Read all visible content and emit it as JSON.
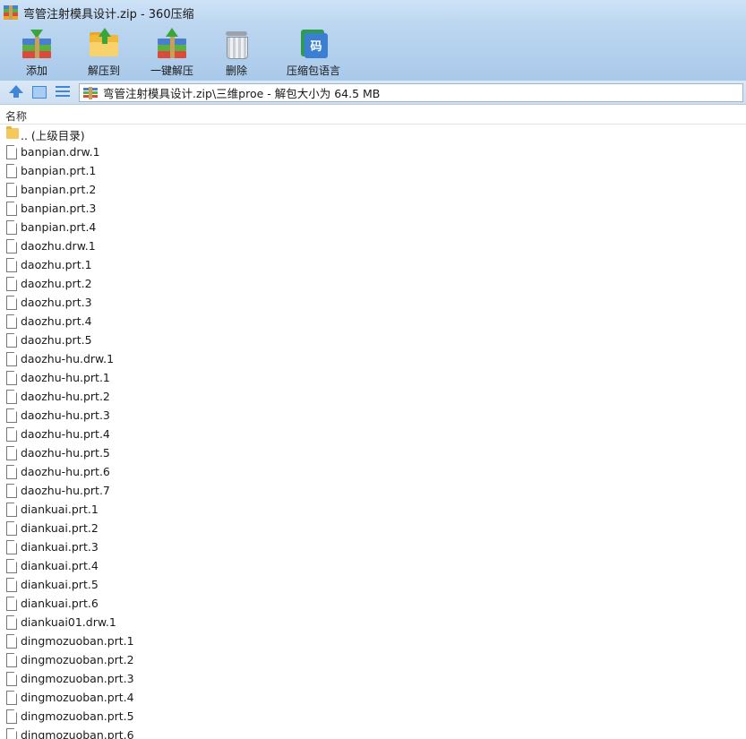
{
  "window": {
    "title": "弯管注射模具设计.zip - 360压缩"
  },
  "toolbar": {
    "buttons": [
      {
        "label": "添加",
        "icon": "add-archive-icon"
      },
      {
        "label": "解压到",
        "icon": "extract-to-folder-icon"
      },
      {
        "label": "一键解压",
        "icon": "one-click-extract-icon"
      },
      {
        "label": "删除",
        "icon": "trash-icon"
      },
      {
        "label": "压缩包语言",
        "icon": "language-icon",
        "glyph": "码"
      }
    ]
  },
  "address": {
    "path": "弯管注射模具设计.zip\\三维proe - 解包大小为 64.5 MB"
  },
  "columns": {
    "name": "名称"
  },
  "files": [
    {
      "name": ".. (上级目录)",
      "type": "folder"
    },
    {
      "name": "banpian.drw.1",
      "type": "file"
    },
    {
      "name": "banpian.prt.1",
      "type": "file"
    },
    {
      "name": "banpian.prt.2",
      "type": "file"
    },
    {
      "name": "banpian.prt.3",
      "type": "file"
    },
    {
      "name": "banpian.prt.4",
      "type": "file"
    },
    {
      "name": "daozhu.drw.1",
      "type": "file"
    },
    {
      "name": "daozhu.prt.1",
      "type": "file"
    },
    {
      "name": "daozhu.prt.2",
      "type": "file"
    },
    {
      "name": "daozhu.prt.3",
      "type": "file"
    },
    {
      "name": "daozhu.prt.4",
      "type": "file"
    },
    {
      "name": "daozhu.prt.5",
      "type": "file"
    },
    {
      "name": "daozhu-hu.drw.1",
      "type": "file"
    },
    {
      "name": "daozhu-hu.prt.1",
      "type": "file"
    },
    {
      "name": "daozhu-hu.prt.2",
      "type": "file"
    },
    {
      "name": "daozhu-hu.prt.3",
      "type": "file"
    },
    {
      "name": "daozhu-hu.prt.4",
      "type": "file"
    },
    {
      "name": "daozhu-hu.prt.5",
      "type": "file"
    },
    {
      "name": "daozhu-hu.prt.6",
      "type": "file"
    },
    {
      "name": "daozhu-hu.prt.7",
      "type": "file"
    },
    {
      "name": "diankuai.prt.1",
      "type": "file"
    },
    {
      "name": "diankuai.prt.2",
      "type": "file"
    },
    {
      "name": "diankuai.prt.3",
      "type": "file"
    },
    {
      "name": "diankuai.prt.4",
      "type": "file"
    },
    {
      "name": "diankuai.prt.5",
      "type": "file"
    },
    {
      "name": "diankuai.prt.6",
      "type": "file"
    },
    {
      "name": "diankuai01.drw.1",
      "type": "file"
    },
    {
      "name": "dingmozuoban.prt.1",
      "type": "file"
    },
    {
      "name": "dingmozuoban.prt.2",
      "type": "file"
    },
    {
      "name": "dingmozuoban.prt.3",
      "type": "file"
    },
    {
      "name": "dingmozuoban.prt.4",
      "type": "file"
    },
    {
      "name": "dingmozuoban.prt.5",
      "type": "file"
    },
    {
      "name": "dingmozuoban.prt.6",
      "type": "file"
    }
  ]
}
